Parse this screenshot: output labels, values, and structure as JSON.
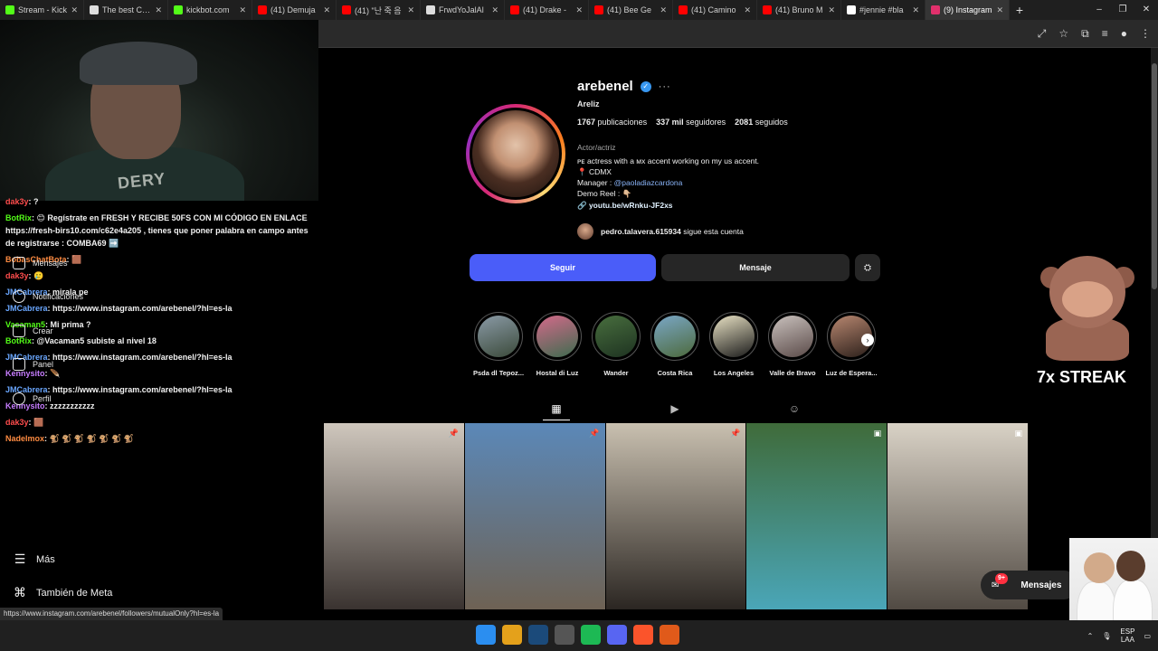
{
  "browser": {
    "tabs": [
      {
        "label": "Stream - Kick",
        "color": "#53fc18"
      },
      {
        "label": "The best Chat",
        "color": "#dddddd"
      },
      {
        "label": "kickbot.com",
        "color": "#53fc18"
      },
      {
        "label": "(41) Demuja",
        "color": "#ff0000"
      },
      {
        "label": "(41) \"난 죽 음",
        "color": "#ff0000"
      },
      {
        "label": "FrwdYoJalAl",
        "color": "#dddddd"
      },
      {
        "label": "(41) Drake -",
        "color": "#ff0000"
      },
      {
        "label": "(41) Bee Ge",
        "color": "#ff0000"
      },
      {
        "label": "(41) Camino",
        "color": "#ff0000"
      },
      {
        "label": "(41) Bruno M",
        "color": "#ff0000"
      },
      {
        "label": "#jennie #bla",
        "color": "#ffffff"
      },
      {
        "label": "(9) Instagram",
        "color": "#e1306c",
        "active": true
      }
    ],
    "new_tab": "+",
    "window_controls": [
      "–",
      "❐",
      "✕"
    ],
    "toolbar_icons": [
      "⤢",
      "☆",
      "⧉",
      "≡",
      "●",
      "⋮"
    ],
    "status_url": "https://www.instagram.com/arebenel/followers/mutualOnly?hl=es-la"
  },
  "stream": {
    "shirt_text": "DERY",
    "chat": [
      {
        "user": "dak3y",
        "color": "#ff4d4d",
        "msg": ": ?"
      },
      {
        "user": "BotRix",
        "color": "#53fc18",
        "msg": ": 😊 Regístrate en FRESH Y RECIBE 50FS CON MI CÓDIGO EN ENLACE https://fresh-birs10.com/c62e4a205 , tienes que poner palabra en campo antes de registrarse : COMBA69 ➡️",
        "wrap": true
      },
      {
        "user": "BobasChatBota",
        "color": "#ff8c42",
        "msg": ": 🟫"
      },
      {
        "user": "dak3y",
        "color": "#ff4d4d",
        "msg": ": 🥲"
      },
      {
        "user": "JMCabrera",
        "color": "#6aa7ff",
        "msg": ": mirala pe"
      },
      {
        "user": "JMCabrera",
        "color": "#6aa7ff",
        "msg": ": https://www.instagram.com/arebenel/?hl=es-la"
      },
      {
        "user": "Vacaman5",
        "color": "#53fc18",
        "msg": ": Mi prima ?"
      },
      {
        "user": "BotRix",
        "color": "#53fc18",
        "msg": ": @Vacaman5 subiste al nivel 18"
      },
      {
        "user": "JMCabrera",
        "color": "#6aa7ff",
        "msg": ": https://www.instagram.com/arebenel/?hl=es-la"
      },
      {
        "user": "Kennysito",
        "color": "#c77dff",
        "msg": ": 🪶"
      },
      {
        "user": "JMCabrera",
        "color": "#6aa7ff",
        "msg": ": https://www.instagram.com/arebenel/?hl=es-la"
      },
      {
        "user": "Kennysito",
        "color": "#c77dff",
        "msg": ": zzzzzzzzzzz"
      },
      {
        "user": "dak3y",
        "color": "#ff4d4d",
        "msg": ": 🟫"
      },
      {
        "user": "Nadelmox",
        "color": "#ff8c42",
        "msg": ": 🐒 🐒 🐒 🐒 🐒 🐒 🐒"
      }
    ],
    "ig_nav_overlay": [
      "Mensajes",
      "Notificaciones",
      "Crear",
      "Panel",
      "Perfil"
    ],
    "more_label": "Más",
    "meta_label": "También de Meta"
  },
  "profile": {
    "username": "arebenel",
    "more_icon": "···",
    "full_name": "Areliz",
    "stats": [
      {
        "value": "1767",
        "label": "publicaciones"
      },
      {
        "value": "337 mil",
        "label": "seguidores"
      },
      {
        "value": "2081",
        "label": "seguidos"
      }
    ],
    "category": "Actor/actriz",
    "bio_line1": "ᴘᴇ actress with a ᴍx accent working on my us accent.",
    "bio_line2": "📍 CDMX",
    "bio_manager_prefix": "Manager : ",
    "bio_manager_handle": "@paoladiazcardona",
    "bio_demo": "Demo Reel : 👇🏼",
    "link": "youtu.be/wRnku-JF2xs",
    "followed_by_user": "pedro.talavera.615934",
    "followed_by_suffix": "sigue esta cuenta",
    "follow_label": "Seguir",
    "message_label": "Mensaje",
    "suggest_icon": "⛭"
  },
  "highlights": [
    {
      "label": "Psda dl Tepoz...",
      "colors": [
        "#8a9aa6",
        "#3b4a3a"
      ]
    },
    {
      "label": "Hostal di Luz",
      "colors": [
        "#d46a8a",
        "#3e6b4f"
      ]
    },
    {
      "label": "Wander",
      "colors": [
        "#486e3e",
        "#1e3321"
      ]
    },
    {
      "label": "Costa Rica",
      "colors": [
        "#7aa7c7",
        "#4d6a3c"
      ]
    },
    {
      "label": "Los Angeles",
      "colors": [
        "#e9e2c4",
        "#1a1a1a"
      ]
    },
    {
      "label": "Valle de Bravo",
      "colors": [
        "#c9c1bd",
        "#5a4a48"
      ]
    },
    {
      "label": "Luz de Espera...",
      "colors": [
        "#b88770",
        "#2b1f1a"
      ]
    }
  ],
  "post_tabs": [
    "▦",
    "▶",
    "☺"
  ],
  "posts": [
    {
      "colors": [
        "#cfc7bd",
        "#3a3330"
      ],
      "icon": "📌"
    },
    {
      "colors": [
        "#5b88b8",
        "#6e6254"
      ],
      "icon": "📌"
    },
    {
      "colors": [
        "#c9c0b0",
        "#2b2622"
      ],
      "icon": "📌"
    },
    {
      "colors": [
        "#3f6b3a",
        "#4aa6b8"
      ],
      "icon": "▣"
    },
    {
      "colors": [
        "#d9d2c6",
        "#514a43"
      ],
      "icon": "▣"
    }
  ],
  "overlay": {
    "streak_text": "7x STREAK",
    "messages_label": "Mensajes",
    "messages_badge": "9+"
  },
  "taskbar": {
    "icons": [
      {
        "name": "windows-start-icon",
        "color": "#2b8ef0"
      },
      {
        "name": "chrome-icon",
        "color": "#e4a11b"
      },
      {
        "name": "steam-icon",
        "color": "#1b4a7a"
      },
      {
        "name": "settings-app-icon",
        "color": "#555555"
      },
      {
        "name": "spotify-icon",
        "color": "#1db954"
      },
      {
        "name": "discord-icon",
        "color": "#5865f2"
      },
      {
        "name": "brave-icon",
        "color": "#fb542b"
      },
      {
        "name": "app-icon",
        "color": "#e05a1a"
      }
    ],
    "lang_top": "ESP",
    "lang_bottom": "LAA"
  }
}
